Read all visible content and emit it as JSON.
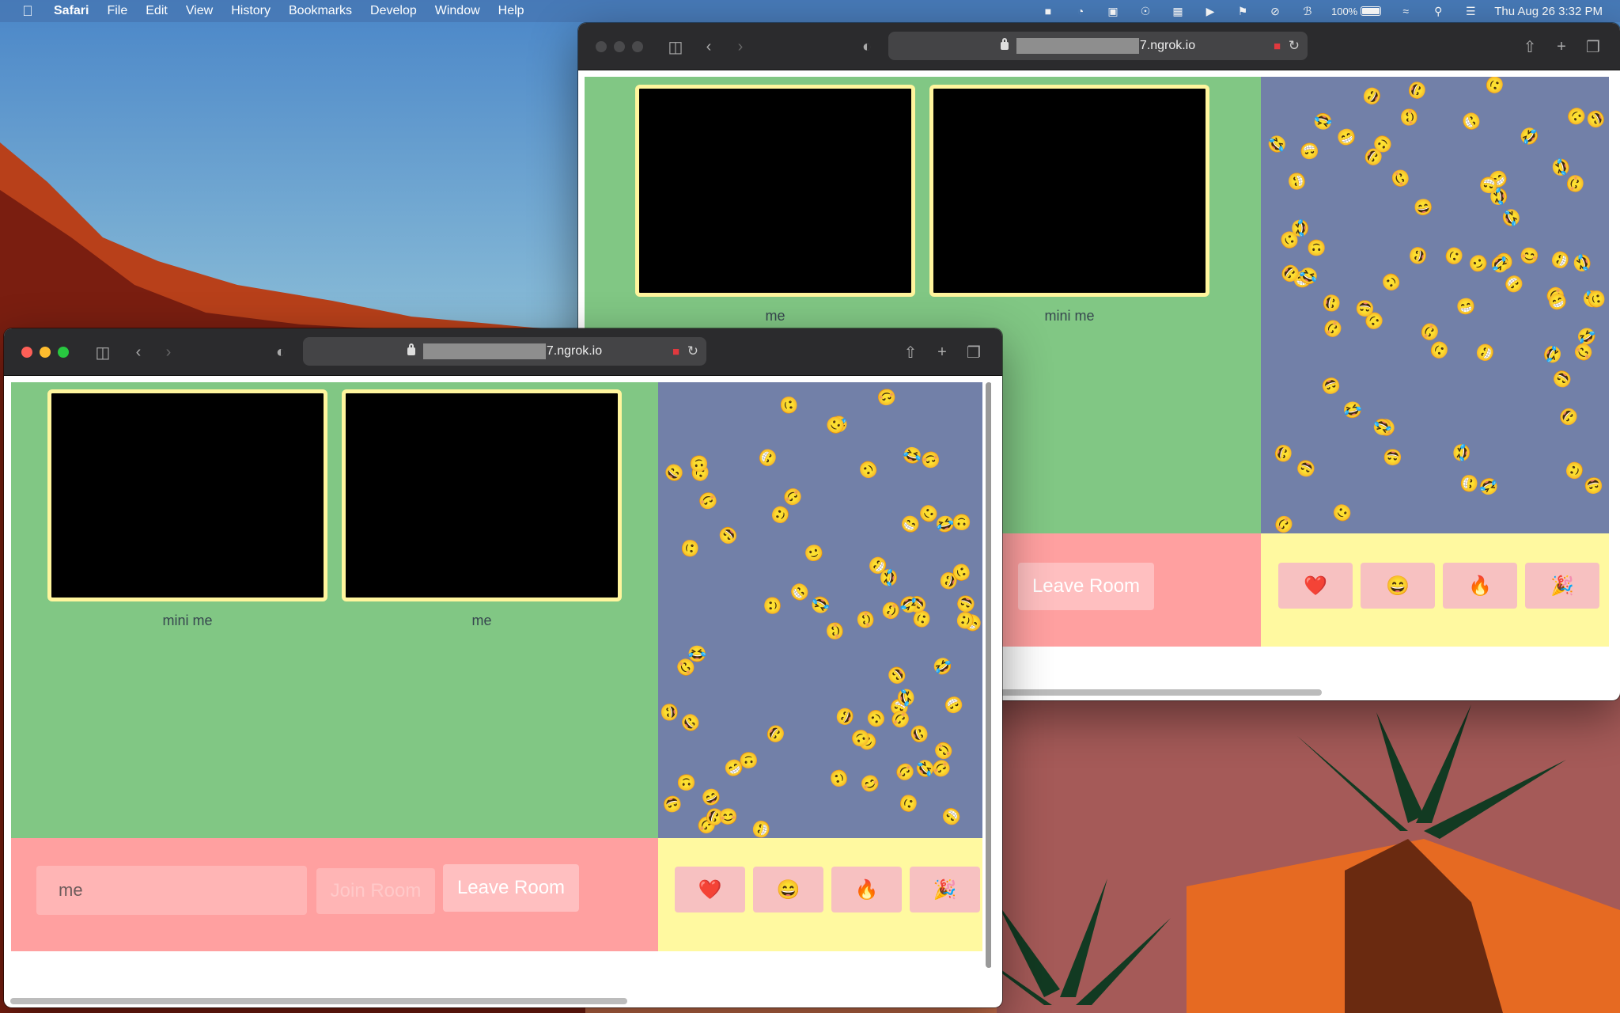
{
  "menubar": {
    "app": "Safari",
    "items": [
      "File",
      "Edit",
      "View",
      "History",
      "Bookmarks",
      "Develop",
      "Window",
      "Help"
    ],
    "battery": "100%",
    "clock": "Thu Aug 26  3:32 PM"
  },
  "back_window": {
    "url_suffix": "7.ngrok.io",
    "videos": [
      {
        "label": "me"
      },
      {
        "label": "mini me"
      }
    ],
    "leave_label": "Leave Room",
    "reactions": [
      "❤️",
      "😄",
      "🔥",
      "🎉"
    ]
  },
  "front_window": {
    "url_suffix": "7.ngrok.io",
    "videos": [
      {
        "label": "mini me"
      },
      {
        "label": "me"
      }
    ],
    "name_input_value": "me",
    "join_label": "Join Room",
    "leave_label": "Leave Room",
    "reactions": [
      "❤️",
      "😄",
      "🔥",
      "🎉"
    ]
  },
  "emoji_set": [
    "🤣",
    "😄",
    "😊",
    "😁",
    "🙂"
  ],
  "colors": {
    "stage": "#81c784",
    "emoji_field": "#7280a8",
    "controls": "#ffa0a0",
    "react_bar": "#fff9a0",
    "video_border": "#fff59d"
  }
}
